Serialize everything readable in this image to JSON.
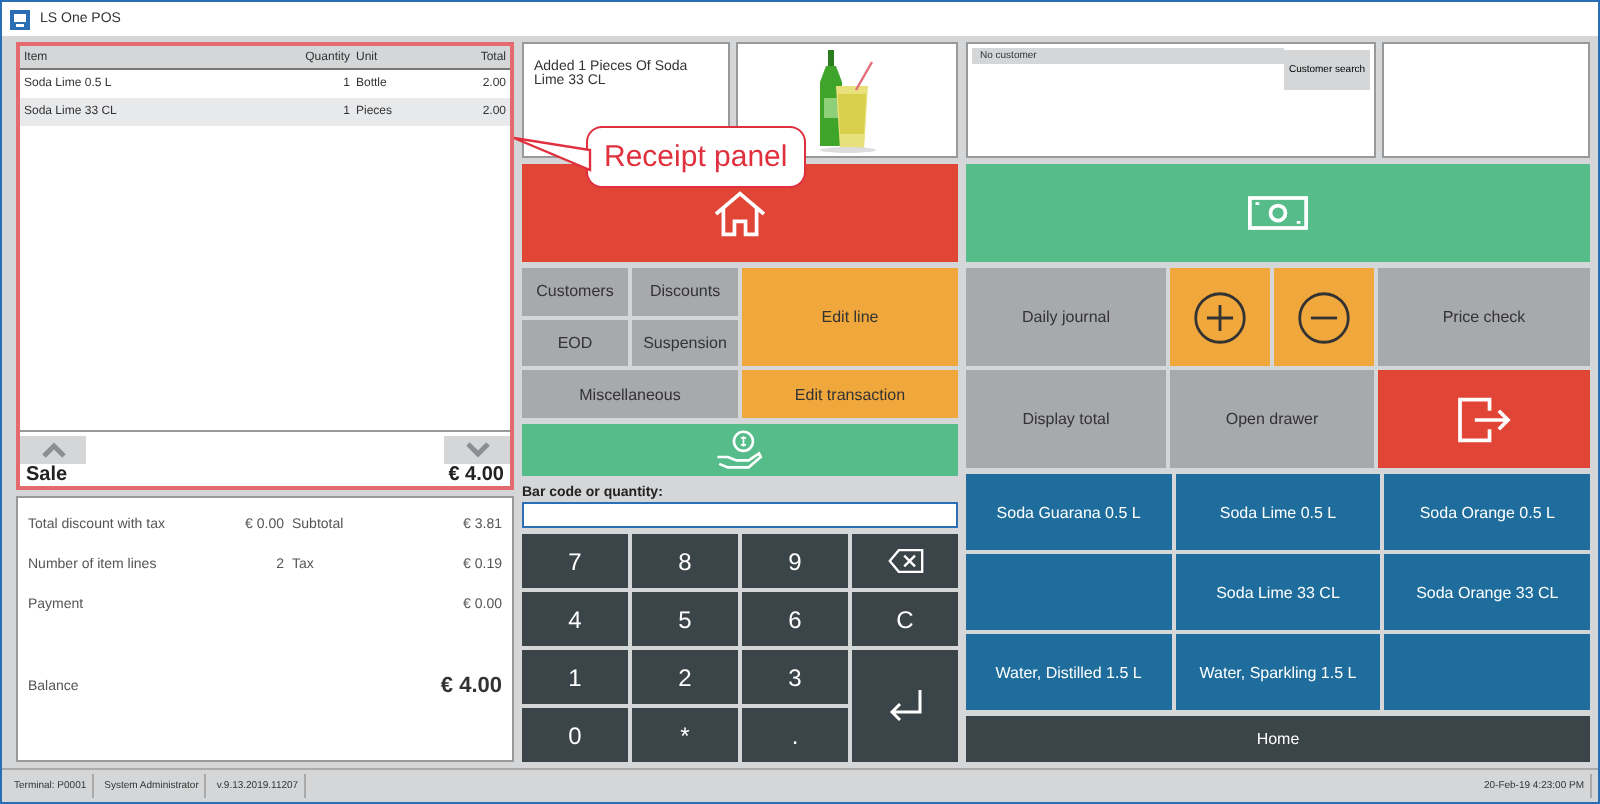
{
  "window": {
    "title": "LS One POS"
  },
  "receipt": {
    "columns": [
      "Item",
      "Quantity",
      "Unit",
      "Total"
    ],
    "rows": [
      {
        "cells": [
          "Soda Lime 0.5 L",
          "1",
          "Bottle",
          "2.00"
        ],
        "selected": false
      },
      {
        "cells": [
          "Soda Lime 33 CL",
          "1",
          "Pieces",
          "2.00"
        ],
        "selected": true
      }
    ],
    "type_label": "Sale",
    "total": "€ 4.00"
  },
  "annotation": {
    "text": "Receipt panel"
  },
  "totals": {
    "rows": [
      {
        "label": "Total discount with tax",
        "value": "€ 0.00",
        "label2": "Subtotal",
        "value2": "€ 3.81"
      },
      {
        "label": "Number of item lines",
        "value": "2",
        "label2": "Tax",
        "value2": "€ 0.19"
      },
      {
        "label": "Payment",
        "value2": "€ 0.00"
      }
    ],
    "balance_label": "Balance",
    "balance": "€ 4.00"
  },
  "message": "Added 1 Pieces Of Soda Lime 33 CL",
  "customer": {
    "name": "No customer",
    "button": "Customer search"
  },
  "operations": [
    "Customers",
    "Discounts",
    "EOD",
    "Suspension"
  ],
  "edit_line": "Edit line",
  "miscellaneous": "Miscellaneous",
  "edit_transaction": "Edit transaction",
  "barcode": {
    "label": "Bar code or quantity:"
  },
  "numpad": [
    {
      "label": "7",
      "kind": "key"
    },
    {
      "label": "8",
      "kind": "key"
    },
    {
      "label": "9",
      "kind": "key"
    },
    {
      "kind": "backspace"
    },
    {
      "label": "4",
      "kind": "key"
    },
    {
      "label": "5",
      "kind": "key"
    },
    {
      "label": "6",
      "kind": "key"
    },
    {
      "label": "C",
      "kind": "key"
    },
    {
      "label": "1",
      "kind": "key"
    },
    {
      "label": "2",
      "kind": "key"
    },
    {
      "label": "3",
      "kind": "key"
    },
    {
      "kind": "enter"
    },
    {
      "label": "0",
      "kind": "key"
    },
    {
      "label": "*",
      "kind": "key"
    },
    {
      "label": ".",
      "kind": "key"
    }
  ],
  "functions": [
    {
      "label": "Daily journal",
      "kind": "text"
    },
    {
      "kind": "plus"
    },
    {
      "kind": "minus"
    },
    {
      "label": "Price check",
      "kind": "text"
    },
    {
      "label": "Display total",
      "kind": "text"
    },
    {
      "label": "Open drawer",
      "kind": "text"
    },
    {
      "kind": "exit"
    }
  ],
  "items": [
    {
      "label": "Soda Guarana 0.5 L",
      "kind": "product"
    },
    {
      "label": "Soda Lime 0.5 L",
      "kind": "product"
    },
    {
      "label": "Soda Orange 0.5 L",
      "kind": "product"
    },
    {
      "kind": "blank"
    },
    {
      "label": "Soda Lime 33 CL",
      "kind": "product"
    },
    {
      "label": "Soda Orange 33 CL",
      "kind": "product"
    },
    {
      "label": "Water, Distilled 1.5 L",
      "kind": "product"
    },
    {
      "label": "Water, Sparkling 1.5 L",
      "kind": "product"
    },
    {
      "kind": "blank"
    }
  ],
  "home": "Home",
  "status_bar": {
    "terminal": "Terminal: P0001",
    "user": "System Administrator",
    "version": "v.9.13.2019.11207",
    "datetime": "20-Feb-19 4:23:00 PM"
  }
}
